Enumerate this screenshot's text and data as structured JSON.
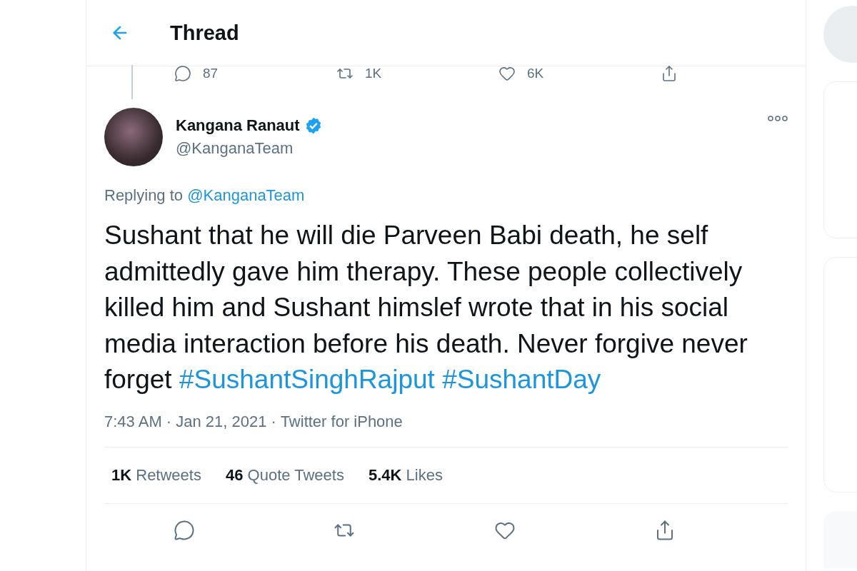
{
  "header": {
    "title": "Thread"
  },
  "parent_actions": [
    {
      "kind": "reply",
      "count": "87"
    },
    {
      "kind": "retweet",
      "count": "1K"
    },
    {
      "kind": "like",
      "count": "6K"
    },
    {
      "kind": "share"
    }
  ],
  "tweet": {
    "name": "Kangana Ranaut",
    "verified": true,
    "handle": "@KanganaTeam",
    "replying_prefix": "Replying to",
    "replying_to": "@KanganaTeam",
    "body": [
      {
        "kind": "plain",
        "text": "Sushant that he will die Parveen Babi death, he self admittedly gave him therapy. These people collectively killed him and Sushant himslef wrote that in his social media interaction before his death. Never forgive never forget "
      },
      {
        "kind": "hashtag",
        "text": "#SushantSinghRajput"
      },
      {
        "kind": "hashtag",
        "text": "#SushantDay"
      }
    ],
    "meta": "7:43 AM · Jan 21, 2021 · Twitter for iPhone",
    "stats": [
      {
        "count": "1K",
        "label": "Retweets"
      },
      {
        "count": "46",
        "label": "Quote Tweets"
      },
      {
        "count": "5.4K",
        "label": "Likes"
      }
    ],
    "actions": [
      {
        "kind": "reply"
      },
      {
        "kind": "retweet"
      },
      {
        "kind": "like"
      },
      {
        "kind": "share"
      }
    ]
  }
}
